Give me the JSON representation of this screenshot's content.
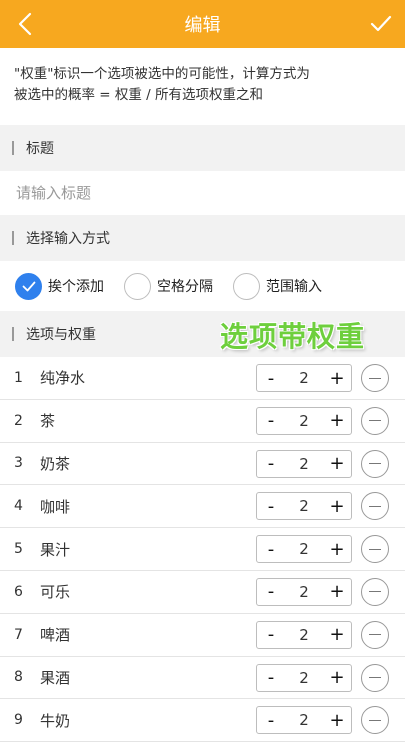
{
  "header": {
    "title": "编辑",
    "accent_color": "#f7a81f",
    "back_icon": "chevron-left-icon",
    "confirm_icon": "checkmark-icon"
  },
  "description": {
    "line1": "\"权重\"标识一个选项被选中的可能性，计算方式为",
    "line2": "被选中的概率 = 权重 / 所有选项权重之和"
  },
  "title_section": {
    "label": "标题",
    "input_placeholder": "请输入标题",
    "input_value": ""
  },
  "input_method": {
    "label": "选择输入方式",
    "selected": "挨个添加",
    "options": [
      "挨个添加",
      "空格分隔",
      "范围输入"
    ],
    "check_color": "#2f80ed"
  },
  "options_section": {
    "label": "选项与权重",
    "overlay_text": "选项带权重",
    "overlay_color": "#6ecf3d",
    "items": [
      {
        "num": "1",
        "name": "纯净水",
        "weight": "2"
      },
      {
        "num": "2",
        "name": "茶",
        "weight": "2"
      },
      {
        "num": "3",
        "name": "奶茶",
        "weight": "2"
      },
      {
        "num": "4",
        "name": "咖啡",
        "weight": "2"
      },
      {
        "num": "5",
        "name": "果汁",
        "weight": "2"
      },
      {
        "num": "6",
        "name": "可乐",
        "weight": "2"
      },
      {
        "num": "7",
        "name": "啤酒",
        "weight": "2"
      },
      {
        "num": "8",
        "name": "果酒",
        "weight": "2"
      },
      {
        "num": "9",
        "name": "牛奶",
        "weight": "2"
      }
    ],
    "decrement_label": "-",
    "increment_label": "+"
  }
}
